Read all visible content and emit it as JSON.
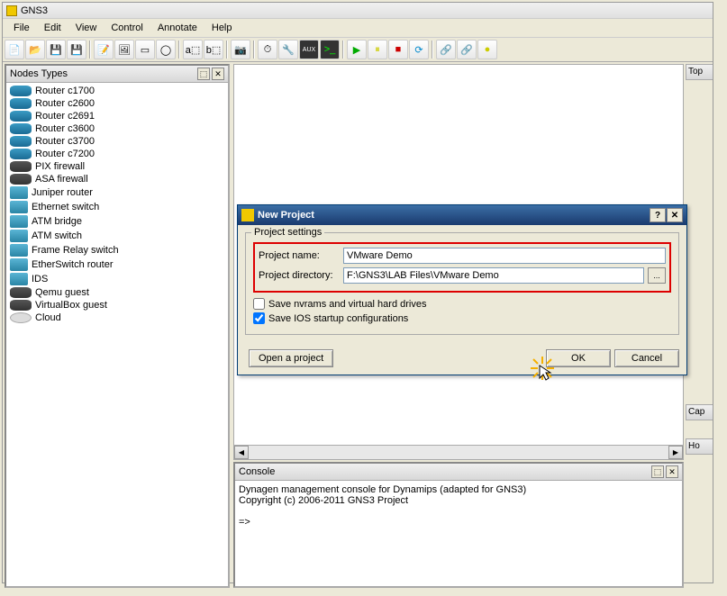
{
  "app": {
    "title": "GNS3"
  },
  "menu": [
    "File",
    "Edit",
    "View",
    "Control",
    "Annotate",
    "Help"
  ],
  "panels": {
    "nodes": {
      "title": "Nodes Types",
      "items": [
        {
          "label": "Router c1700",
          "icon": "router"
        },
        {
          "label": "Router c2600",
          "icon": "router"
        },
        {
          "label": "Router c2691",
          "icon": "router"
        },
        {
          "label": "Router c3600",
          "icon": "router"
        },
        {
          "label": "Router c3700",
          "icon": "router"
        },
        {
          "label": "Router c7200",
          "icon": "router"
        },
        {
          "label": "PIX firewall",
          "icon": "fw"
        },
        {
          "label": "ASA firewall",
          "icon": "fw"
        },
        {
          "label": "Juniper router",
          "icon": "sw"
        },
        {
          "label": "Ethernet switch",
          "icon": "sw"
        },
        {
          "label": "ATM bridge",
          "icon": "sw"
        },
        {
          "label": "ATM switch",
          "icon": "sw"
        },
        {
          "label": "Frame Relay switch",
          "icon": "sw"
        },
        {
          "label": "EtherSwitch router",
          "icon": "sw"
        },
        {
          "label": "IDS",
          "icon": "sw"
        },
        {
          "label": "Qemu guest",
          "icon": "fw"
        },
        {
          "label": "VirtualBox guest",
          "icon": "fw"
        },
        {
          "label": "Cloud",
          "icon": "oval"
        }
      ]
    },
    "console": {
      "title": "Console",
      "line1": "Dynagen management console for Dynamips (adapted for GNS3)",
      "line2": "Copyright (c) 2006-2011 GNS3 Project",
      "prompt": "=>"
    },
    "rightStubs": [
      "Top",
      "Cap",
      "Ho"
    ]
  },
  "dialog": {
    "title": "New Project",
    "fieldsetLegend": "Project settings",
    "projectNameLabel": "Project name:",
    "projectNameValue": "VMware Demo",
    "projectDirLabel": "Project directory:",
    "projectDirValue": "F:\\GNS3\\LAB Files\\VMware Demo",
    "browseLabel": "...",
    "chk1": {
      "label": "Save nvrams and virtual hard drives",
      "checked": false
    },
    "chk2": {
      "label": "Save IOS startup configurations",
      "checked": true
    },
    "openBtn": "Open a project",
    "okBtn": "OK",
    "cancelBtn": "Cancel"
  }
}
